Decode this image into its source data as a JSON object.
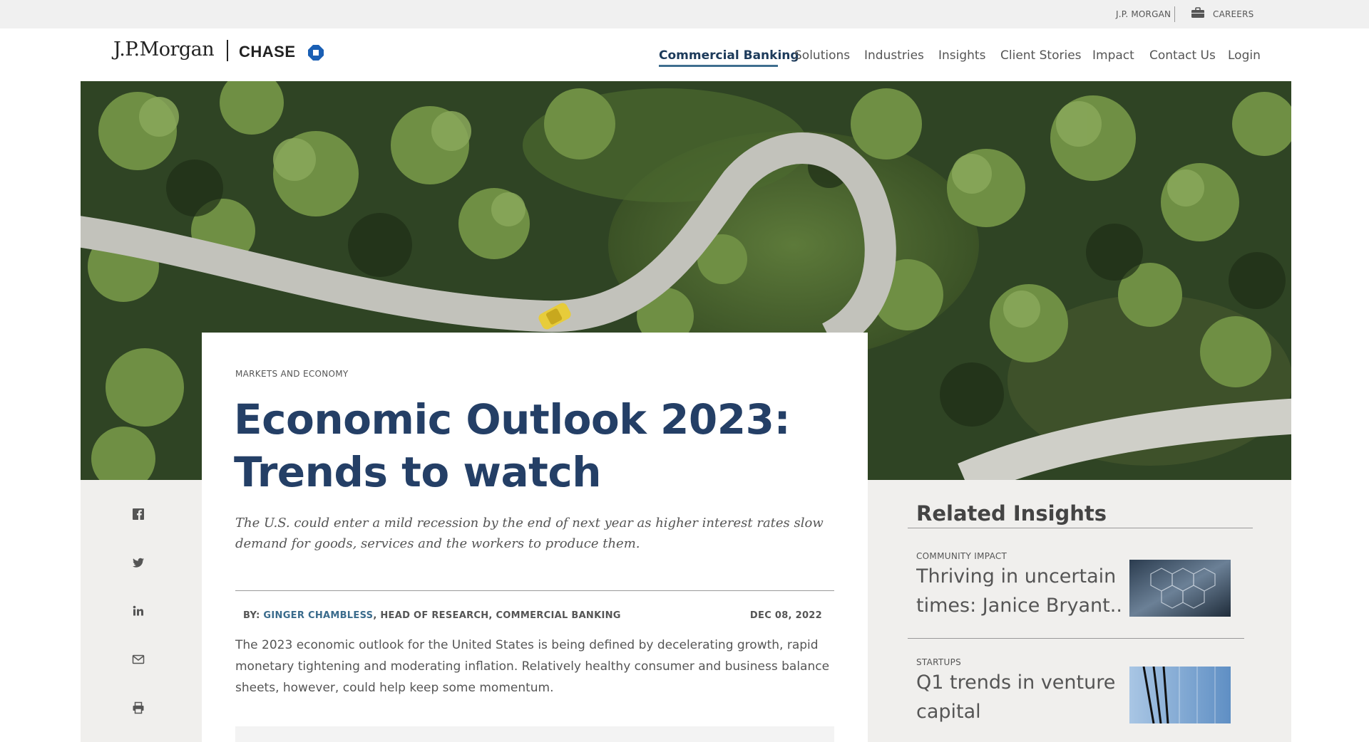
{
  "utility": {
    "jpmorgan_label": "J.P. MORGAN",
    "careers_label": "CAREERS"
  },
  "header": {
    "logo_jpm": "J.P.Morgan",
    "logo_chase": "CHASE",
    "nav": [
      {
        "label": "Commercial Banking",
        "active": true
      },
      {
        "label": "Solutions"
      },
      {
        "label": "Industries"
      },
      {
        "label": "Insights"
      },
      {
        "label": "Client Stories"
      },
      {
        "label": "Impact"
      },
      {
        "label": "Contact Us"
      },
      {
        "label": "Login"
      }
    ]
  },
  "hero": {
    "image_desc_icon": "aerial-forest-road-image"
  },
  "article": {
    "eyebrow": "MARKETS AND ECONOMY",
    "title": "Economic Outlook 2023: Trends to watch",
    "subtitle": "The U.S. could enter a mild recession by the end of next year as higher interest rates slow demand for goods, services and the workers to produce them.",
    "byline_prefix": "BY: ",
    "author": "GINGER CHAMBLESS",
    "author_role": ", HEAD OF RESEARCH, COMMERCIAL BANKING",
    "date": "DEC 08, 2022",
    "body": "The 2023 economic outlook for the United States is being defined by decelerating growth, rapid monetary tightening and moderating inflation. Relatively healthy consumer and business balance sheets, however, could help keep some momentum."
  },
  "social": [
    {
      "icon": "facebook-icon"
    },
    {
      "icon": "twitter-icon"
    },
    {
      "icon": "linkedin-icon"
    },
    {
      "icon": "email-icon"
    },
    {
      "icon": "print-icon"
    }
  ],
  "related": {
    "heading": "Related Insights",
    "items": [
      {
        "category": "COMMUNITY IMPACT",
        "title_line1": "Thriving in uncertain",
        "title_line2": "times: Janice Bryant..."
      },
      {
        "category": "STARTUPS",
        "title_line1": "Q1 trends in venture",
        "title_line2": "capital"
      }
    ]
  },
  "colors": {
    "brand_navy": "#243f66",
    "link_blue": "#3a6b8c",
    "nav_underline": "#3f6e8f",
    "chase_blue": "#1a5fb4"
  }
}
